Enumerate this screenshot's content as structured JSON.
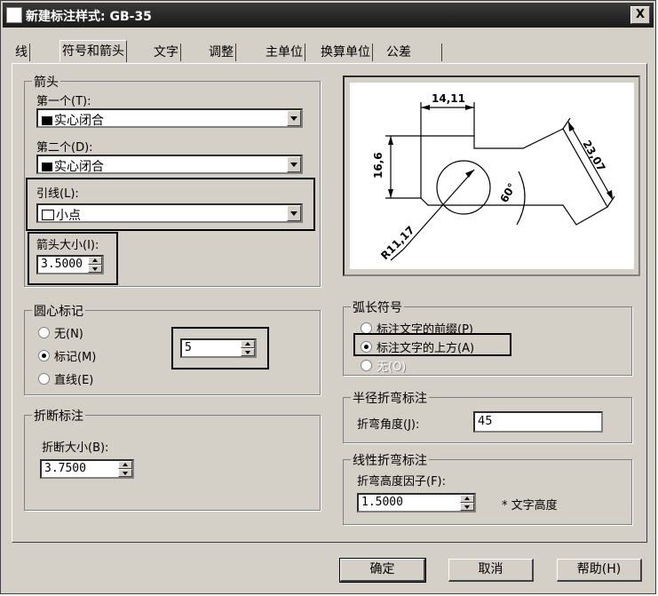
{
  "window": {
    "title": "新建标注样式: GB-35",
    "close_label": "X"
  },
  "tabs": [
    "线",
    "符号和箭头",
    "文字",
    "调整",
    "主单位",
    "换算单位",
    "公差"
  ],
  "arrows": {
    "group_title": "箭头",
    "first_label": "第一个(T):",
    "first_value": "实心闭合",
    "second_label": "第二个(D):",
    "second_value": "实心闭合",
    "leader_label": "引线(L):",
    "leader_value": "小点",
    "size_label": "箭头大小(I):",
    "size_value": "3.5000"
  },
  "center_marks": {
    "group_title": "圆心标记",
    "options": [
      "无(N)",
      "标记(M)",
      "直线(E)"
    ],
    "selected": "标记(M)",
    "size_value": "5"
  },
  "break": {
    "group_title": "折断标注",
    "size_label": "折断大小(B):",
    "size_value": "3.7500"
  },
  "arc_length": {
    "group_title": "弧长符号",
    "options": [
      "标注文字的前缀(P)",
      "标注文字的上方(A)",
      "无(O)"
    ],
    "selected": "标注文字的上方(A)"
  },
  "radius_jog": {
    "group_title": "半径折弯标注",
    "angle_label": "折弯角度(J):",
    "angle_value": "45"
  },
  "linear_jog": {
    "group_title": "线性折弯标注",
    "factor_label": "折弯高度因子(F):",
    "factor_value": "1.5000",
    "suffix": "* 文字高度"
  },
  "preview": {
    "dim_top": "14,11",
    "dim_left": "16,6",
    "dim_aligned": "23,07",
    "dim_angle": "60°",
    "dim_radius": "R11,17"
  },
  "buttons": {
    "ok": "确定",
    "cancel": "取消",
    "help": "帮助(H)"
  }
}
